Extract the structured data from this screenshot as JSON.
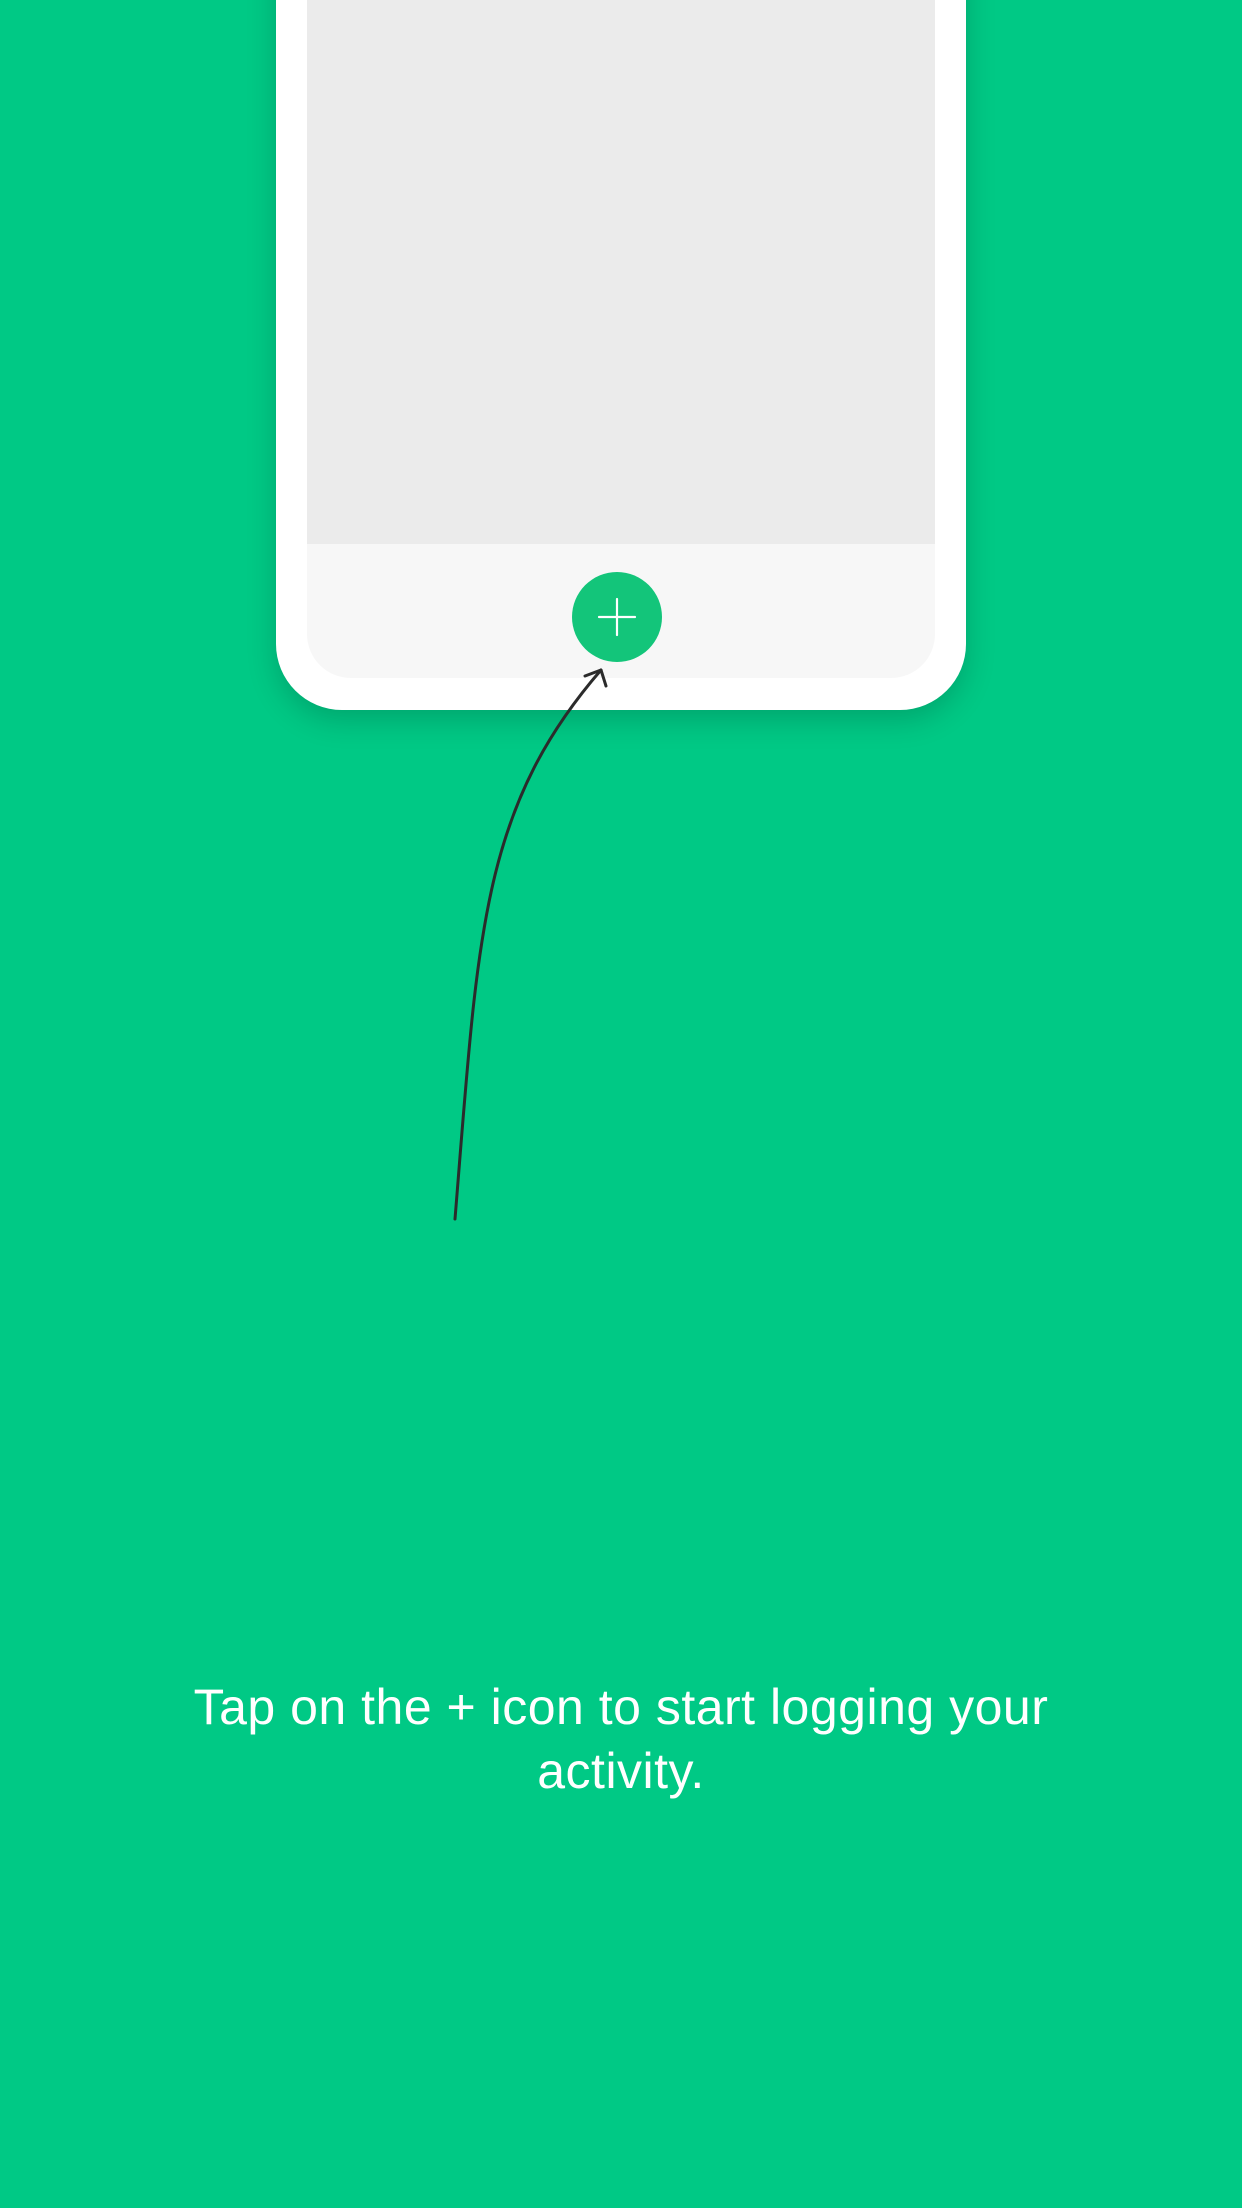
{
  "colors": {
    "background": "#00c985",
    "phone_frame": "#ffffff",
    "phone_content": "#ebebeb",
    "tab_bar": "#f7f7f7",
    "accent": "#13c57a",
    "plus_glyph": "#ffffff",
    "arrow": "#2b2b2b",
    "caption_text": "#ffffff"
  },
  "phone": {
    "add_button": {
      "icon": "plus-icon"
    }
  },
  "arrow": {
    "icon": "curved-arrow-pointer"
  },
  "onboarding": {
    "caption": "Tap on the + icon to start logging your activity."
  }
}
